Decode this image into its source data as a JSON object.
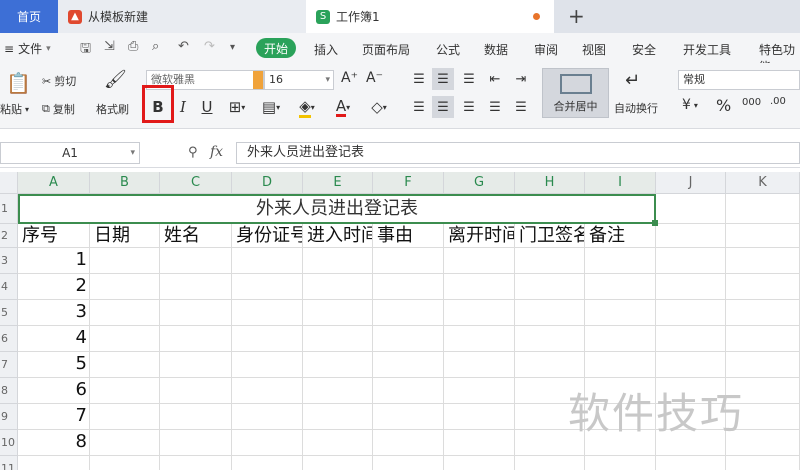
{
  "tabs": {
    "home": "首页",
    "template": "从模板新建",
    "workbook": "工作簿1",
    "add": "+"
  },
  "menu": {
    "file": "文件",
    "start": "开始",
    "items": [
      "插入",
      "页面布局",
      "公式",
      "数据",
      "审阅",
      "视图",
      "安全",
      "开发工具",
      "特色功能"
    ]
  },
  "ribbon": {
    "cut": "剪切",
    "paste": "粘贴",
    "copy": "复制",
    "format_painter": "格式刷",
    "font_name": "微软雅黑",
    "font_size": "16",
    "grow_font": "A⁺",
    "shrink_font": "A⁻",
    "bold": "B",
    "italic": "I",
    "underline": "U",
    "merge_center": "合并居中",
    "wrap_text": "自动换行",
    "number_format": "常规",
    "percent": "%"
  },
  "formula_bar": {
    "cell_ref": "A1",
    "fx": "fx",
    "content": "外来人员进出登记表"
  },
  "sheet": {
    "columns": [
      "A",
      "B",
      "C",
      "D",
      "E",
      "F",
      "G",
      "H",
      "I",
      "J",
      "K"
    ],
    "rows": [
      "1",
      "2",
      "3",
      "4",
      "5",
      "6",
      "7",
      "8",
      "9",
      "10",
      "11"
    ],
    "title": "外来人员进出登记表",
    "headers": [
      "序号",
      "日期",
      "姓名",
      "身份证号",
      "进入时间",
      "事由",
      "离开时间",
      "门卫签名",
      "备注"
    ],
    "serials": [
      "1",
      "2",
      "3",
      "4",
      "5",
      "6",
      "7",
      "8"
    ]
  },
  "watermark": "软件技巧",
  "colors": {
    "accent_green": "#2aa25a",
    "home_tab_blue": "#3d6fd6",
    "highlight_red": "#e11919"
  }
}
